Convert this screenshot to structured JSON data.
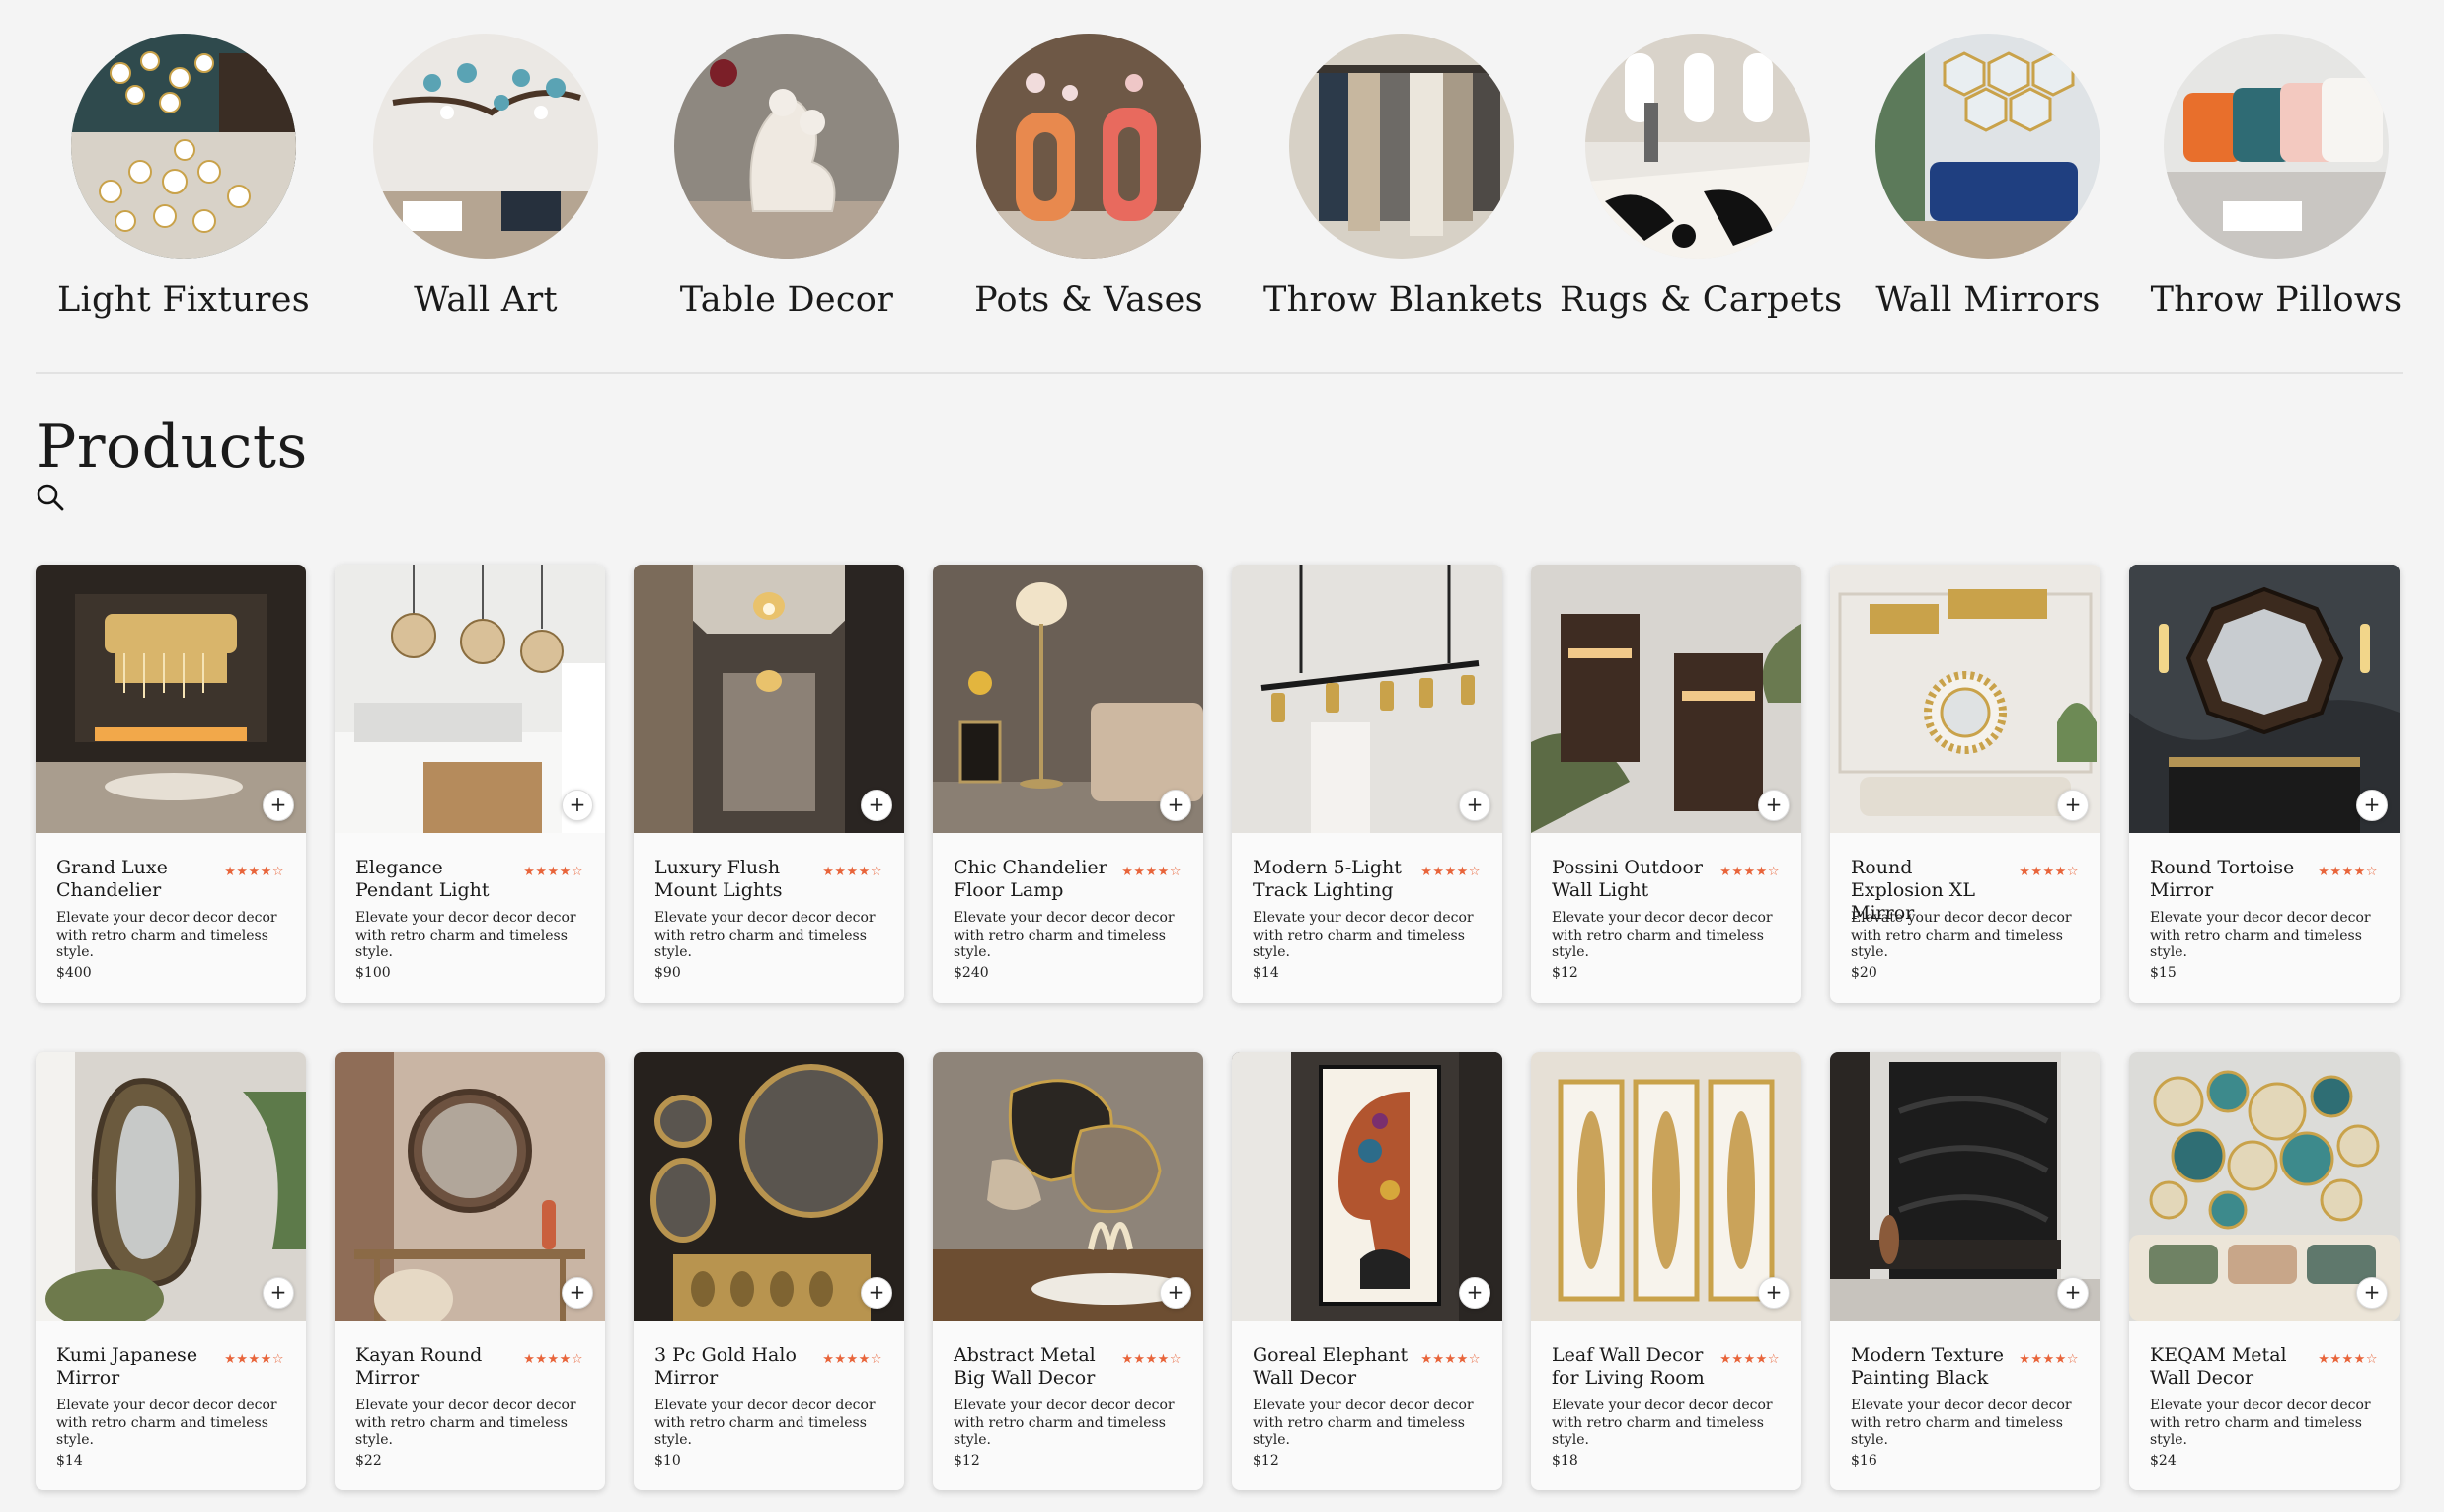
{
  "categories": [
    {
      "label": "Light Fixtures",
      "icon": "chandelier-photo"
    },
    {
      "label": "Wall Art",
      "icon": "wall-art-photo"
    },
    {
      "label": "Table Decor",
      "icon": "sculpture-photo"
    },
    {
      "label": "Pots & Vases",
      "icon": "vases-photo"
    },
    {
      "label": "Throw Blankets",
      "icon": "blankets-photo"
    },
    {
      "label": "Rugs & Carpets",
      "icon": "rug-photo"
    },
    {
      "label": "Wall Mirrors",
      "icon": "hexagon-mirror-photo"
    },
    {
      "label": "Throw Pillows",
      "icon": "pillows-photo"
    }
  ],
  "products_section": {
    "title": "Products",
    "search_icon": "search-icon"
  },
  "colors": {
    "background": "#f4f4f4",
    "card": "#fafafa",
    "star_accent": "#e8643a",
    "text": "#1a1a1a"
  },
  "products": [
    {
      "name": "Grand Luxe Chandelier",
      "rating": "★★★★☆",
      "description": "Elevate your decor decor decor with retro charm and timeless style.",
      "price": "$400",
      "image": "gold-chandelier-living-room"
    },
    {
      "name": "Elegance Pendant Light",
      "rating": "★★★★☆",
      "description": "Elevate your decor decor decor with retro charm and timeless style.",
      "price": "$100",
      "image": "glass-pendant-kitchen"
    },
    {
      "name": "Luxury Flush Mount Lights",
      "rating": "★★★★☆",
      "description": "Elevate your decor decor decor with retro charm and timeless style.",
      "price": "$90",
      "image": "flush-mount-hallway"
    },
    {
      "name": "Chic Chandelier Floor Lamp",
      "rating": "★★★★☆",
      "description": "Elevate your decor decor decor with retro charm and timeless style.",
      "price": "$240",
      "image": "crystal-floor-lamp"
    },
    {
      "name": "Modern 5-Light Track Lighting",
      "rating": "★★★★☆",
      "description": "Elevate your decor decor decor with retro charm and timeless style.",
      "price": "$14",
      "image": "track-lighting"
    },
    {
      "name": "Possini Outdoor Wall Light",
      "rating": "★★★★☆",
      "description": "Elevate your decor decor decor with retro charm and timeless style.",
      "price": "$12",
      "image": "outdoor-wall-sconces"
    },
    {
      "name": "Round Explosion XL Mirror",
      "rating": "★★★★☆",
      "description": "Elevate your decor decor decor with retro charm and timeless style.",
      "price": "$20",
      "image": "sunburst-mirror"
    },
    {
      "name": "Round Tortoise Mirror",
      "rating": "★★★★☆",
      "description": "Elevate your decor decor decor with retro charm and timeless style.",
      "price": "$15",
      "image": "octagon-tortoise-mirror"
    },
    {
      "name": "Kumi Japanese Mirror",
      "rating": "★★★★☆",
      "description": "Elevate your decor decor decor with retro charm and timeless style.",
      "price": "$14",
      "image": "organic-layered-mirror"
    },
    {
      "name": "Kayan Round Mirror",
      "rating": "★★★★☆",
      "description": "Elevate your decor decor decor with retro charm and timeless style.",
      "price": "$22",
      "image": "round-mirror-console"
    },
    {
      "name": "3 Pc Gold Halo Mirror",
      "rating": "★★★★☆",
      "description": "Elevate your decor decor decor with retro charm and timeless style.",
      "price": "$10",
      "image": "gold-halo-mirrors"
    },
    {
      "name": "Abstract Metal Big Wall Decor",
      "rating": "★★★★☆",
      "description": "Elevate your decor decor decor with retro charm and timeless style.",
      "price": "$12",
      "image": "abstract-metal-wall-art"
    },
    {
      "name": "Goreal Elephant Wall Decor",
      "rating": "★★★★☆",
      "description": "Elevate your decor decor decor with retro charm and timeless style.",
      "price": "$12",
      "image": "elephant-canvas"
    },
    {
      "name": "Leaf Wall Decor for Living Room",
      "rating": "★★★★☆",
      "description": "Elevate your decor decor decor with retro charm and timeless style.",
      "price": "$18",
      "image": "framed-leaves"
    },
    {
      "name": "Modern Texture Painting Black",
      "rating": "★★★★☆",
      "description": "Elevate your decor decor decor with retro charm and timeless style.",
      "price": "$16",
      "image": "black-texture-painting"
    },
    {
      "name": "KEQAM Metal Wall Decor",
      "rating": "★★★★☆",
      "description": "Elevate your decor decor decor with retro charm and timeless style.",
      "price": "$24",
      "image": "metal-lotus-wall-decor"
    }
  ],
  "add_button_label": "+"
}
